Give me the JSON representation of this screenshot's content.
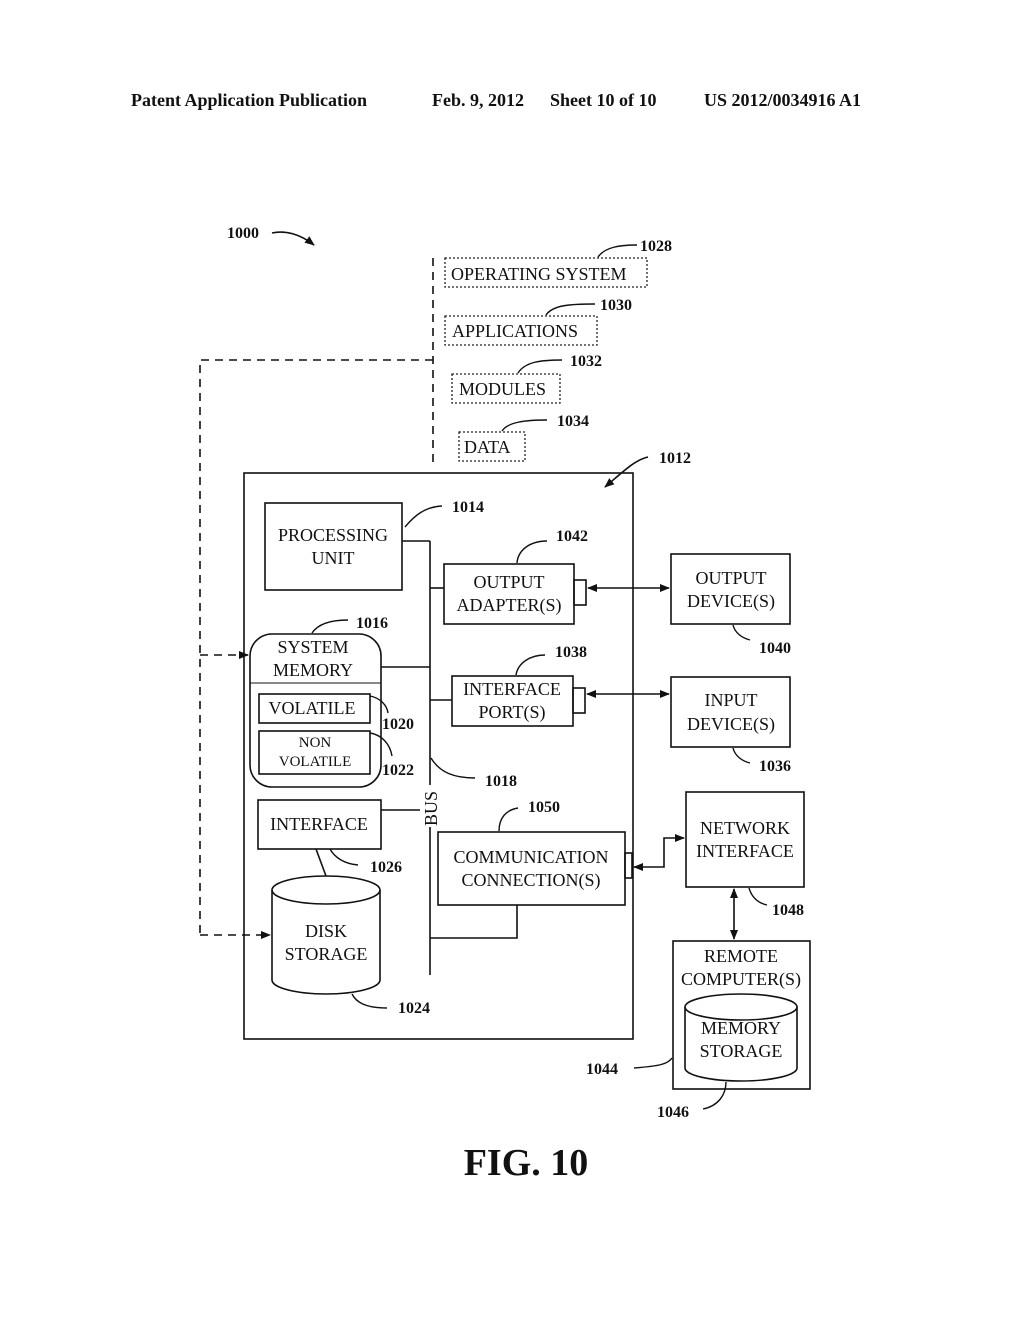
{
  "header": {
    "publication": "Patent Application Publication",
    "date": "Feb. 9, 2012",
    "sheet": "Sheet 10 of 10",
    "patent_number": "US 2012/0034916 A1"
  },
  "figure": {
    "caption": "FIG. 10",
    "system_ref": "1000",
    "computer_ref": "1012"
  },
  "software": [
    {
      "label": "OPERATING SYSTEM",
      "ref": "1028"
    },
    {
      "label": "APPLICATIONS",
      "ref": "1030"
    },
    {
      "label": "MODULES",
      "ref": "1032"
    },
    {
      "label": "DATA",
      "ref": "1034"
    }
  ],
  "components": {
    "processing_unit": {
      "line1": "PROCESSING",
      "line2": "UNIT",
      "ref": "1014"
    },
    "system_memory": {
      "line1": "SYSTEM",
      "line2": "MEMORY",
      "ref": "1016"
    },
    "volatile": {
      "label": "VOLATILE",
      "ref": "1020"
    },
    "non_volatile": {
      "line1": "NON",
      "line2": "VOLATILE",
      "ref": "1022"
    },
    "bus": {
      "label": "BUS",
      "ref": "1018"
    },
    "interface": {
      "label": "INTERFACE",
      "ref": "1026"
    },
    "disk_storage": {
      "line1": "DISK",
      "line2": "STORAGE",
      "ref": "1024"
    },
    "output_adapter": {
      "line1": "OUTPUT",
      "line2": "ADAPTER(S)",
      "ref": "1042"
    },
    "interface_port": {
      "line1": "INTERFACE",
      "line2": "PORT(S)",
      "ref": "1038"
    },
    "communication_connection": {
      "line1": "COMMUNICATION",
      "line2": "CONNECTION(S)",
      "ref": "1050"
    },
    "output_device": {
      "line1": "OUTPUT",
      "line2": "DEVICE(S)",
      "ref": "1040"
    },
    "input_device": {
      "line1": "INPUT",
      "line2": "DEVICE(S)",
      "ref": "1036"
    },
    "network_interface": {
      "line1": "NETWORK",
      "line2": "INTERFACE",
      "ref": "1048"
    },
    "remote_computer": {
      "line1": "REMOTE",
      "line2": "COMPUTER(S)",
      "ref": "1044"
    },
    "memory_storage": {
      "line1": "MEMORY",
      "line2": "STORAGE",
      "ref": "1046"
    }
  }
}
